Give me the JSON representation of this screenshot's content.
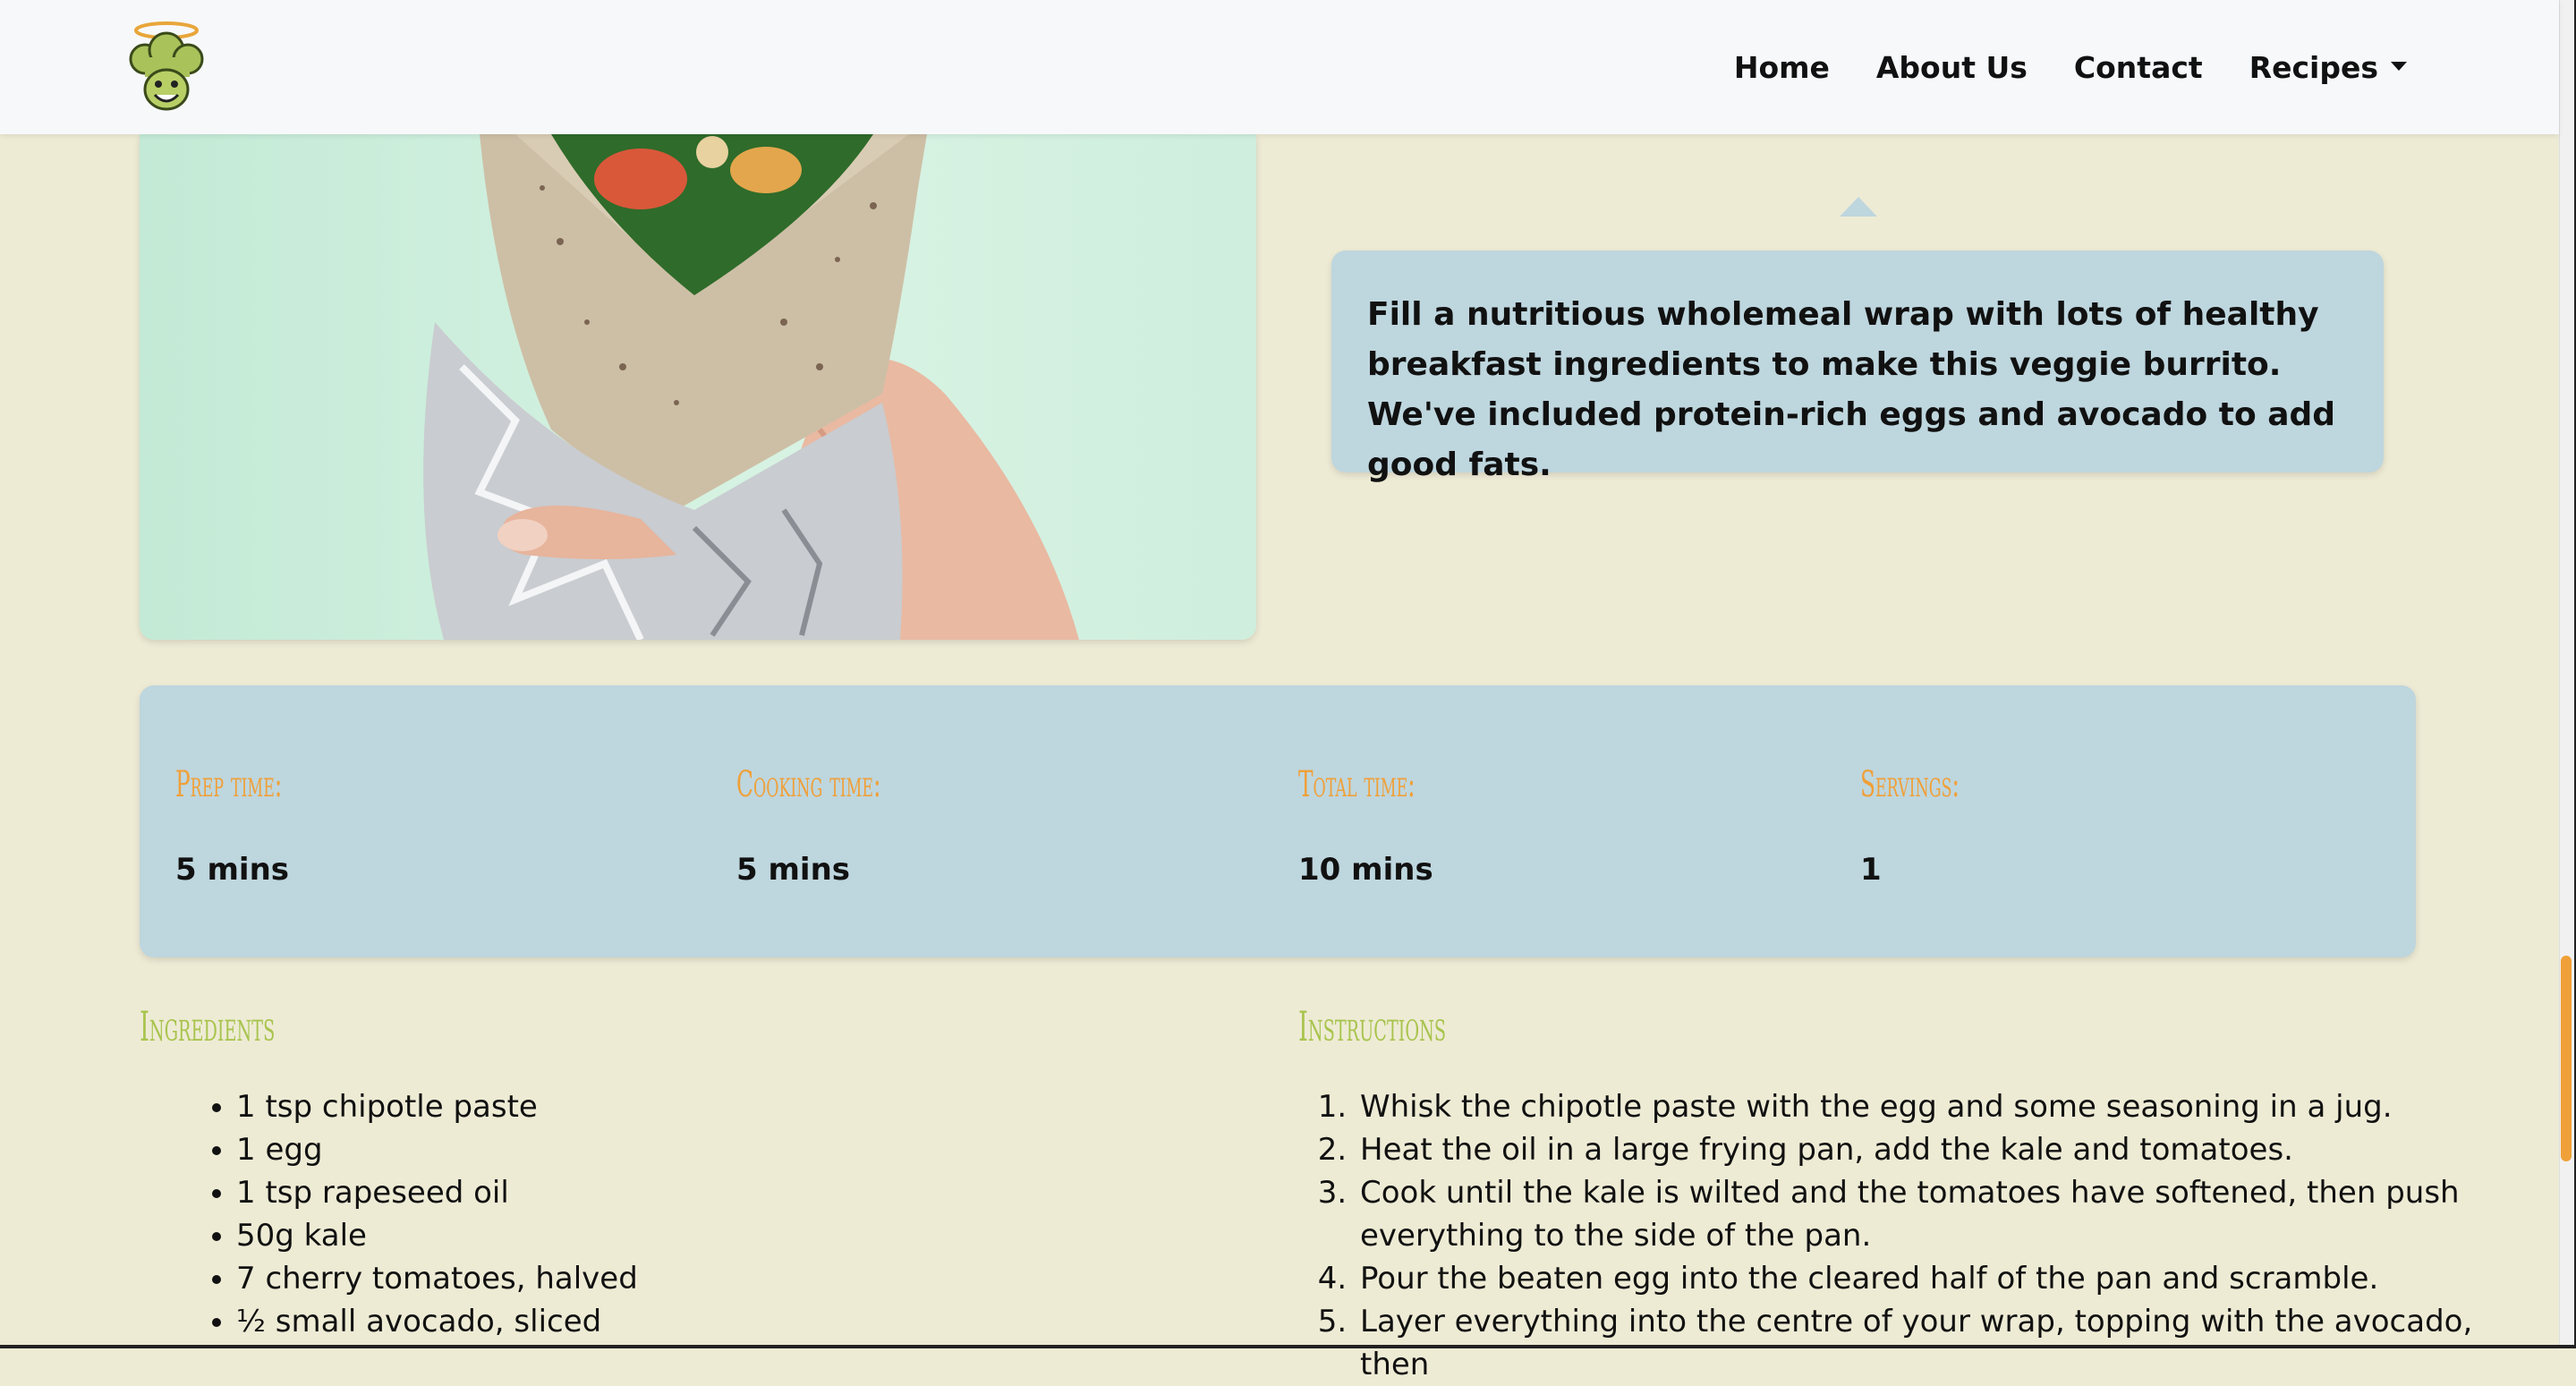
{
  "nav": {
    "logo_alt": "chef mascot logo",
    "links": [
      "Home",
      "About Us",
      "Contact",
      "Recipes"
    ]
  },
  "recipe": {
    "description": "Fill a nutritious wholemeal wrap with lots of healthy breakfast ingredients to make this veggie burrito. We've included protein-rich eggs and avocado to add good fats."
  },
  "stats": [
    {
      "label": "Prep time:",
      "value": "5 mins"
    },
    {
      "label": "Cooking time:",
      "value": "5 mins"
    },
    {
      "label": "Total time:",
      "value": "10 mins"
    },
    {
      "label": "Servings:",
      "value": "1"
    }
  ],
  "ingredients": {
    "title": "Ingredients",
    "items": [
      "1 tsp chipotle paste",
      "1 egg",
      "1 tsp rapeseed oil",
      "50g kale",
      "7 cherry tomatoes, halved",
      "½ small avocado, sliced"
    ]
  },
  "instructions": {
    "title": "Instructions",
    "steps": [
      "Whisk the chipotle paste with the egg and some seasoning in a jug.",
      "Heat the oil in a large frying pan, add the kale and tomatoes.",
      "Cook until the kale is wilted and the tomatoes have softened, then push everything to the side of the pan.",
      "Pour the beaten egg into the cleared half of the pan and scramble.",
      "Layer everything into the centre of your wrap, topping with the avocado, then"
    ]
  },
  "colors": {
    "background": "#eeebd5",
    "panel": "#bed6de",
    "stat_label": "#f0a038",
    "section_title": "#a8c44e",
    "scroll_thumb": "#f0a038"
  }
}
